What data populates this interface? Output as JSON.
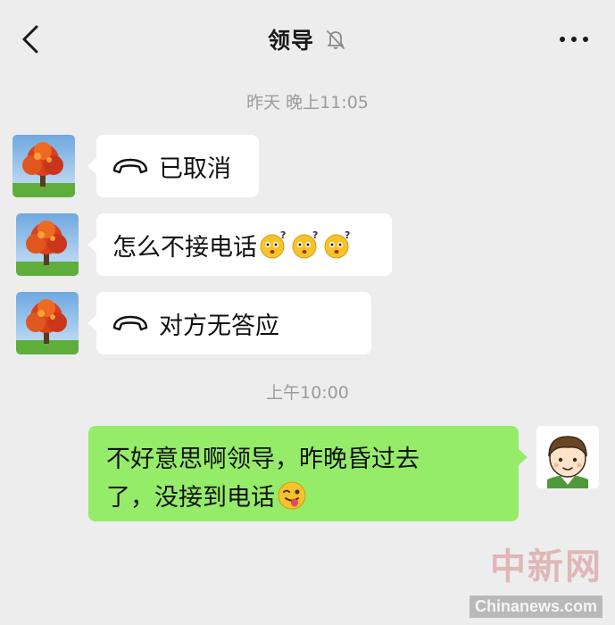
{
  "header": {
    "title": "领导",
    "back_icon": "chevron-left-icon",
    "mute_icon": "bell-off-icon",
    "more_icon": "ellipsis-icon"
  },
  "timestamps": [
    "昨天 晚上11:05",
    "上午10:00"
  ],
  "messages": [
    {
      "side": "left",
      "type": "call",
      "icon": "phone-hangup-icon",
      "text": "已取消"
    },
    {
      "side": "left",
      "type": "text",
      "text": "怎么不接电话",
      "emoji": "confused-emoji",
      "emoji_count": 3
    },
    {
      "side": "left",
      "type": "call",
      "icon": "phone-hangup-icon",
      "text": "对方无答应"
    },
    {
      "side": "right",
      "type": "text",
      "line1": "不好意思啊领导，昨晚昏过去",
      "line2": "了，没接到电话",
      "emoji": "tongue-wink-emoji"
    }
  ],
  "watermark": {
    "logo": "中新网",
    "url": "Chinanews.com"
  },
  "colors": {
    "background": "#ededed",
    "incoming_bubble": "#ffffff",
    "outgoing_bubble": "#95ec69",
    "timestamp": "#9b9b9b"
  }
}
